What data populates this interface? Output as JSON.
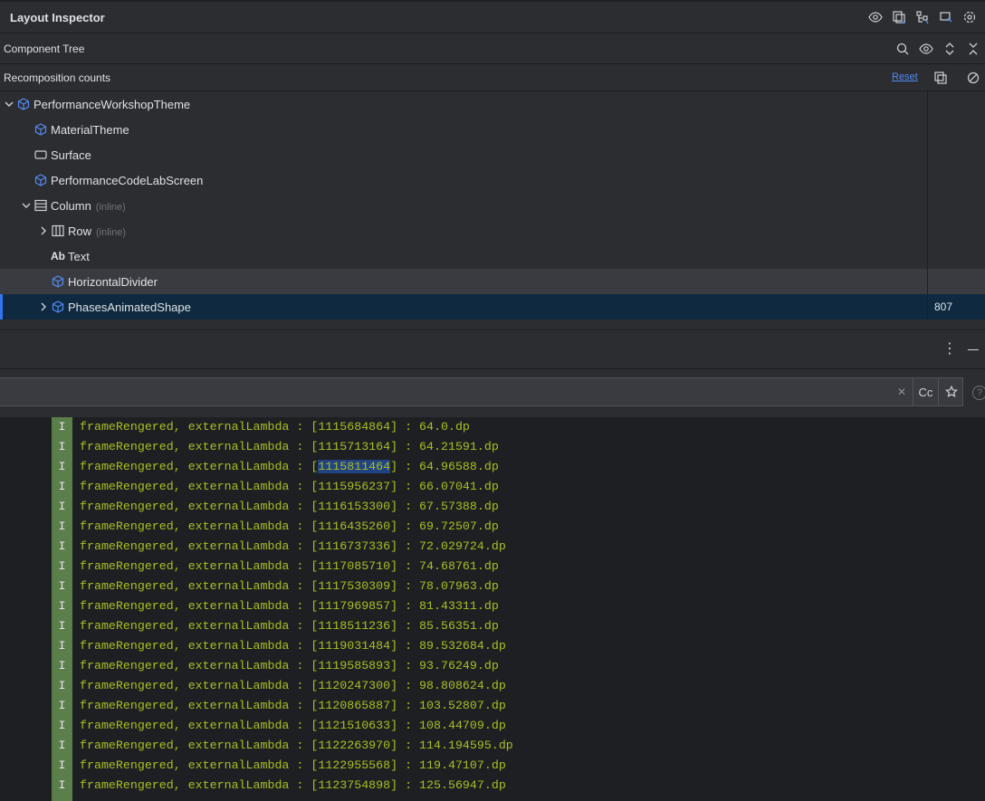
{
  "header": {
    "title": "Layout Inspector"
  },
  "component_tree": {
    "label": "Component Tree"
  },
  "recomposition": {
    "label": "Recomposition counts",
    "reset_label": "Reset"
  },
  "tree": [
    {
      "name": "PerformanceWorkshopTheme",
      "icon": "compose-icon",
      "expanded": true
    },
    {
      "name": "MaterialTheme",
      "icon": "compose-icon"
    },
    {
      "name": "Surface",
      "icon": "surface-icon"
    },
    {
      "name": "PerformanceCodeLabScreen",
      "icon": "compose-icon"
    },
    {
      "name": "Column",
      "suffix": "(inline)",
      "icon": "column-icon",
      "expanded": true
    },
    {
      "name": "Row",
      "suffix": "(inline)",
      "icon": "row-icon",
      "expanded": false
    },
    {
      "name": "Text",
      "icon_text": "Ab"
    },
    {
      "name": "HorizontalDivider",
      "icon": "compose-icon"
    },
    {
      "name": "PhasesAnimatedShape",
      "icon": "compose-icon",
      "expanded": false,
      "count": "807"
    }
  ],
  "filter": {
    "value": "",
    "case_label": "Cc",
    "help_label": "?"
  },
  "logs": [
    {
      "level": "I",
      "pre": "frameRengered, externalLambda : [",
      "id": "1115684864",
      "post": "] : 64.0.dp"
    },
    {
      "level": "I",
      "pre": "frameRengered, externalLambda : [",
      "id": "1115713164",
      "post": "] : 64.21591.dp"
    },
    {
      "level": "I",
      "pre": "frameRengered, externalLambda : [",
      "id": "1115811464",
      "post": "] : 64.96588.dp"
    },
    {
      "level": "I",
      "pre": "frameRengered, externalLambda : [",
      "id": "1115956237",
      "post": "] : 66.07041.dp"
    },
    {
      "level": "I",
      "pre": "frameRengered, externalLambda : [",
      "id": "1116153300",
      "post": "] : 67.57388.dp"
    },
    {
      "level": "I",
      "pre": "frameRengered, externalLambda : [",
      "id": "1116435260",
      "post": "] : 69.72507.dp"
    },
    {
      "level": "I",
      "pre": "frameRengered, externalLambda : [",
      "id": "1116737336",
      "post": "] : 72.029724.dp"
    },
    {
      "level": "I",
      "pre": "frameRengered, externalLambda : [",
      "id": "1117085710",
      "post": "] : 74.68761.dp"
    },
    {
      "level": "I",
      "pre": "frameRengered, externalLambda : [",
      "id": "1117530309",
      "post": "] : 78.07963.dp"
    },
    {
      "level": "I",
      "pre": "frameRengered, externalLambda : [",
      "id": "1117969857",
      "post": "] : 81.43311.dp"
    },
    {
      "level": "I",
      "pre": "frameRengered, externalLambda : [",
      "id": "1118511236",
      "post": "] : 85.56351.dp"
    },
    {
      "level": "I",
      "pre": "frameRengered, externalLambda : [",
      "id": "1119031484",
      "post": "] : 89.532684.dp"
    },
    {
      "level": "I",
      "pre": "frameRengered, externalLambda : [",
      "id": "1119585893",
      "post": "] : 93.76249.dp"
    },
    {
      "level": "I",
      "pre": "frameRengered, externalLambda : [",
      "id": "1120247300",
      "post": "] : 98.808624.dp"
    },
    {
      "level": "I",
      "pre": "frameRengered, externalLambda : [",
      "id": "1120865887",
      "post": "] : 103.52807.dp"
    },
    {
      "level": "I",
      "pre": "frameRengered, externalLambda : [",
      "id": "1121510633",
      "post": "] : 108.44709.dp"
    },
    {
      "level": "I",
      "pre": "frameRengered, externalLambda : [",
      "id": "1122263970",
      "post": "] : 114.194595.dp"
    },
    {
      "level": "I",
      "pre": "frameRengered, externalLambda : [",
      "id": "1122955568",
      "post": "] : 119.47107.dp"
    },
    {
      "level": "I",
      "pre": "frameRengered, externalLambda : [",
      "id": "1123754898",
      "post": "] : 125.56947.dp"
    }
  ],
  "colors": {
    "accent": "#3574f0",
    "link": "#548af7",
    "log_text": "#a8c023",
    "level_bg": "#5b7f4b",
    "selection": "#0f2a40",
    "highlight": "#214283"
  }
}
